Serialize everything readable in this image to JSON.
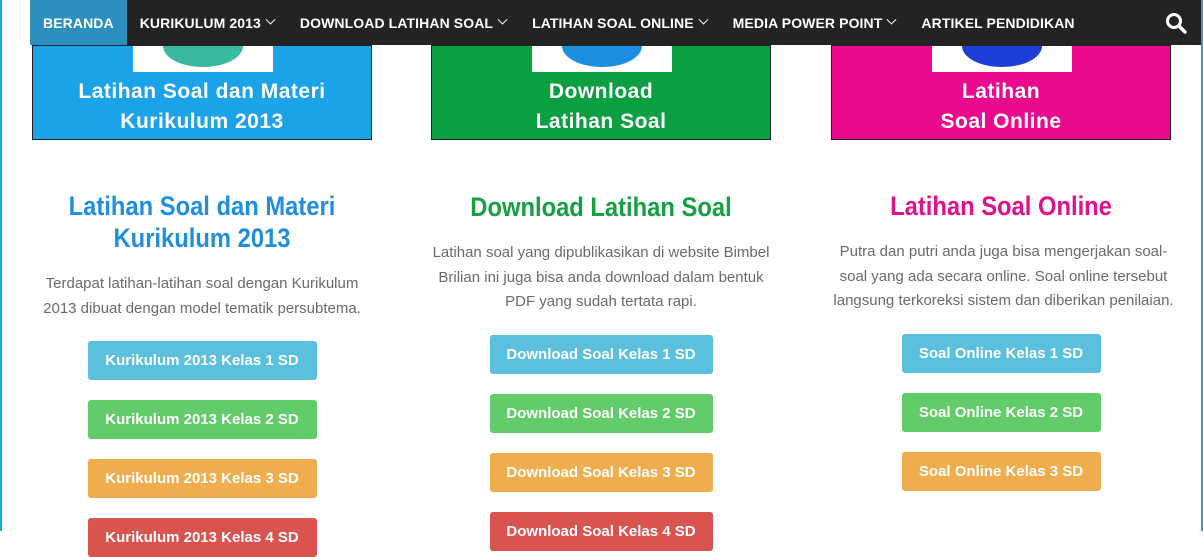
{
  "nav": {
    "items": [
      {
        "label": "BERANDA",
        "dropdown": false,
        "active": true
      },
      {
        "label": "KURIKULUM 2013",
        "dropdown": true
      },
      {
        "label": "DOWNLOAD LATIHAN SOAL",
        "dropdown": true
      },
      {
        "label": "LATIHAN SOAL ONLINE",
        "dropdown": true
      },
      {
        "label": "MEDIA POWER POINT",
        "dropdown": true
      },
      {
        "label": "ARTIKEL PENDIDIKAN",
        "dropdown": false
      }
    ],
    "search_icon": "search-icon"
  },
  "columns": [
    {
      "banner": {
        "line1": "Latihan Soal dan Materi",
        "line2": "Kurikulum 2013",
        "color": "#1aa3e8"
      },
      "heading": "Latihan Soal dan Materi Kurikulum 2013",
      "heading_color": "#1e8fe0",
      "description": "Terdapat latihan-latihan soal dengan Kurikulum 2013 dibuat dengan model tematik persubtema.",
      "buttons": [
        "Kurikulum 2013 Kelas 1 SD",
        "Kurikulum 2013 Kelas 2 SD",
        "Kurikulum 2013 Kelas 3 SD",
        "Kurikulum 2013 Kelas 4 SD"
      ]
    },
    {
      "banner": {
        "line1": "Download",
        "line2": "Latihan Soal",
        "color": "#0aa041"
      },
      "heading": "Download Latihan Soal",
      "heading_color": "#15a043",
      "description": "Latihan soal yang dipublikasikan di website Bimbel Brilian ini juga bisa anda download dalam bentuk PDF yang sudah tertata rapi.",
      "buttons": [
        "Download Soal Kelas 1 SD",
        "Download Soal Kelas 2 SD",
        "Download Soal Kelas 3 SD",
        "Download Soal Kelas 4 SD"
      ]
    },
    {
      "banner": {
        "line1": "Latihan",
        "line2": "Soal Online",
        "color": "#ea0a8e"
      },
      "heading": "Latihan Soal Online",
      "heading_color": "#e0118b",
      "description": "Putra dan putri anda juga bisa mengerjakan soal-soal yang ada secara online. Soal online tersebut langsung terkoreksi sistem dan diberikan penilaian.",
      "buttons": [
        "Soal Online Kelas 1 SD",
        "Soal Online Kelas 2 SD",
        "Soal Online Kelas 3 SD"
      ]
    }
  ]
}
